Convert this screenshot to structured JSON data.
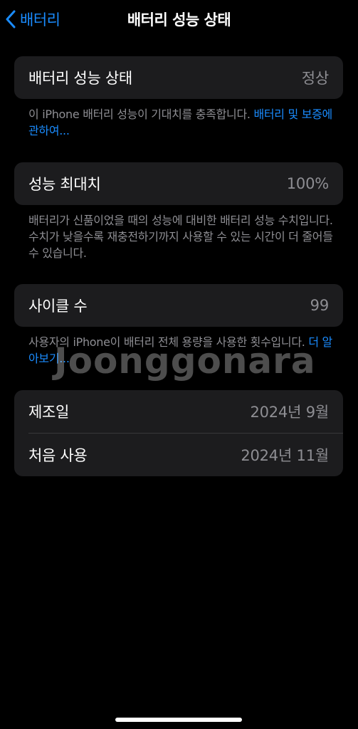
{
  "nav": {
    "back_label": "배터리",
    "title": "배터리 성능 상태"
  },
  "health": {
    "label": "배터리 성능 상태",
    "value": "정상",
    "note_text": "이 iPhone 배터리 성능이 기대치를 충족합니다. ",
    "note_link": "배터리 및 보증에 관하여..."
  },
  "capacity": {
    "label": "성능 최대치",
    "value": "100%",
    "note_text": "배터리가 신품이었을 때의 성능에 대비한 배터리 성능 수치입니다. 수치가 낮을수록 재충전하기까지 사용할 수 있는 시간이 더 줄어들 수 있습니다."
  },
  "cycles": {
    "label": "사이클 수",
    "value": "99",
    "note_text": "사용자의 iPhone이 배터리 전체 용량을 사용한 횟수입니다. ",
    "note_link": "더 알아보기..."
  },
  "dates": {
    "manufacture_label": "제조일",
    "manufacture_value": "2024년 9월",
    "first_use_label": "처음 사용",
    "first_use_value": "2024년 11월"
  },
  "watermark": "Joonggonara",
  "colors": {
    "accent": "#1a8cff",
    "card": "#1c1c1e",
    "secondary_text": "#8e8e93"
  }
}
